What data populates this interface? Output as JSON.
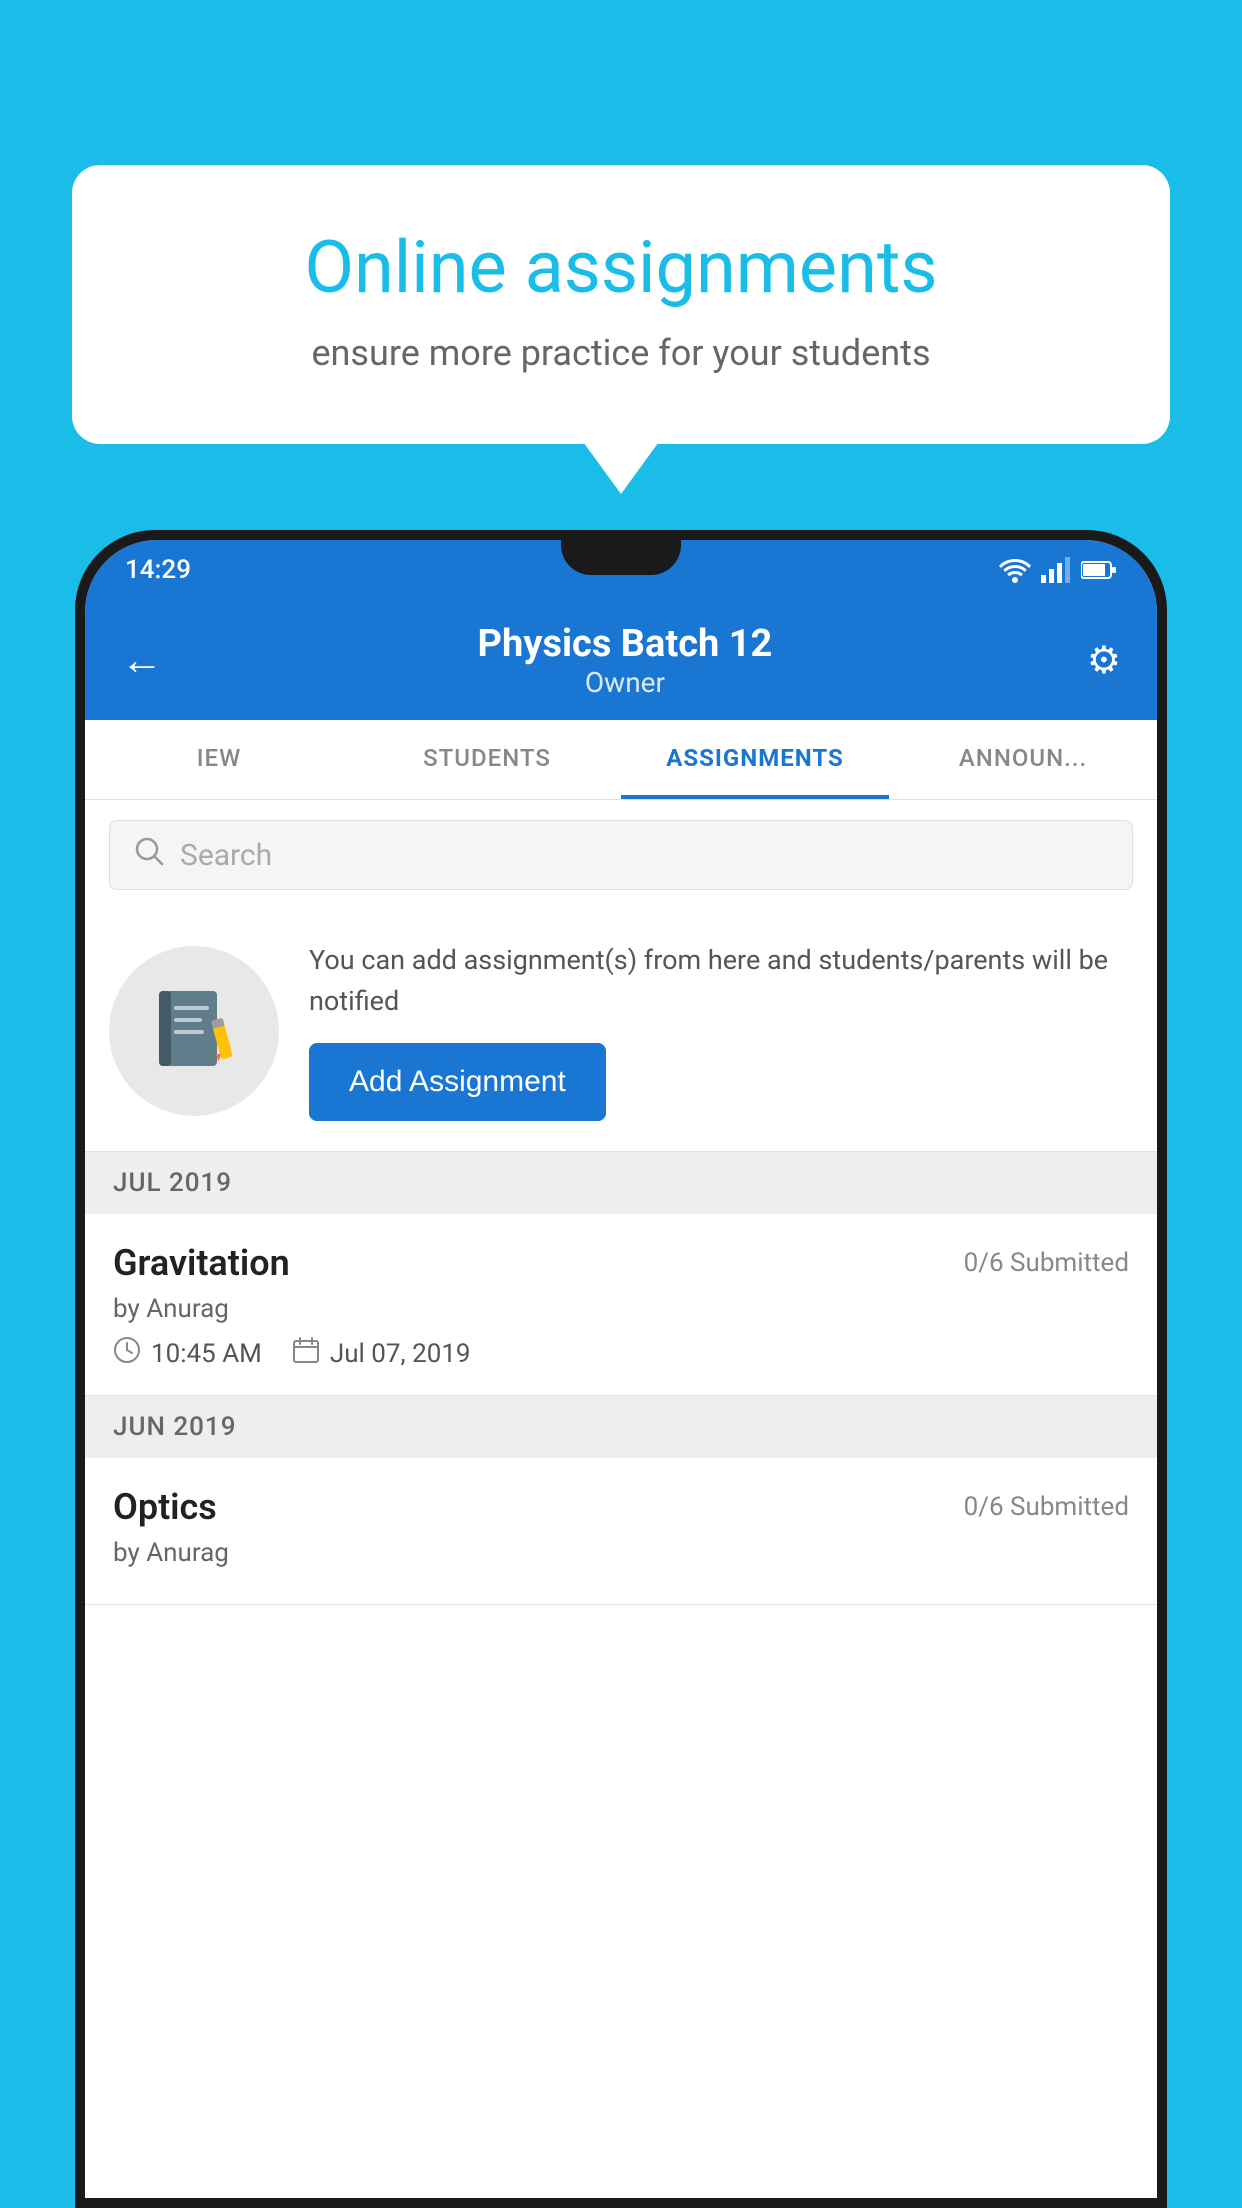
{
  "background_color": "#1ABDE8",
  "speech_bubble": {
    "title": "Online assignments",
    "subtitle": "ensure more practice for your students"
  },
  "phone": {
    "status_bar": {
      "time": "14:29",
      "wifi": "▲",
      "signal": "▲",
      "battery": "▌"
    },
    "app_bar": {
      "back_label": "←",
      "title": "Physics Batch 12",
      "subtitle": "Owner",
      "settings_label": "⚙"
    },
    "tabs": [
      {
        "label": "IEW",
        "active": false
      },
      {
        "label": "STUDENTS",
        "active": false
      },
      {
        "label": "ASSIGNMENTS",
        "active": true
      },
      {
        "label": "ANNOUNCEMENTS",
        "active": false
      }
    ],
    "search": {
      "placeholder": "Search"
    },
    "add_assignment": {
      "description": "You can add assignment(s) from here and students/parents will be notified",
      "button_label": "Add Assignment"
    },
    "assignment_groups": [
      {
        "month_label": "JUL 2019",
        "assignments": [
          {
            "name": "Gravitation",
            "submitted": "0/6 Submitted",
            "author": "by Anurag",
            "time": "10:45 AM",
            "date": "Jul 07, 2019"
          }
        ]
      },
      {
        "month_label": "JUN 2019",
        "assignments": [
          {
            "name": "Optics",
            "submitted": "0/6 Submitted",
            "author": "by Anurag",
            "time": "",
            "date": ""
          }
        ]
      }
    ]
  }
}
